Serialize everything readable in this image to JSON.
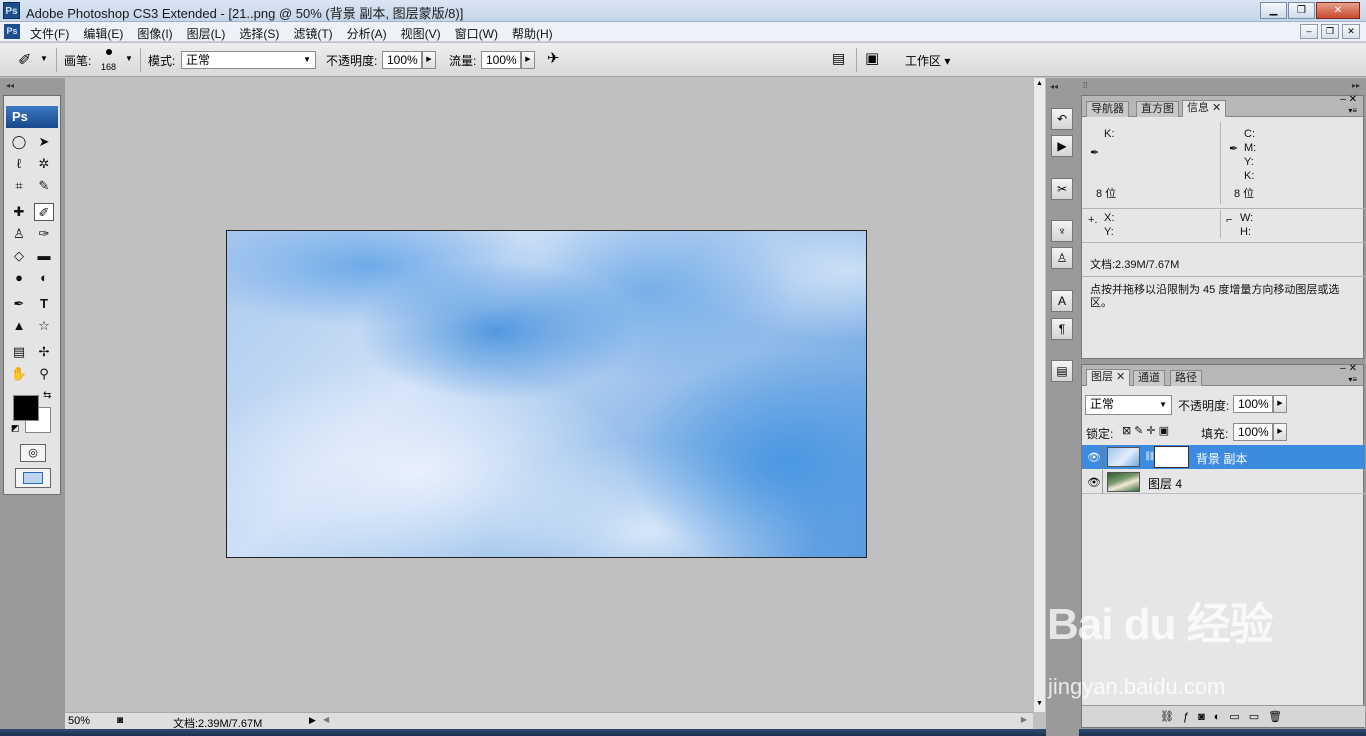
{
  "window": {
    "title": "Adobe Photoshop CS3 Extended - [21..png @ 50% (背景 副本, 图层蒙版/8)]",
    "app_icon": "Ps",
    "buttons": [
      "minimize",
      "maximize",
      "close"
    ]
  },
  "menu": {
    "items": [
      "文件(F)",
      "编辑(E)",
      "图像(I)",
      "图层(L)",
      "选择(S)",
      "滤镜(T)",
      "分析(A)",
      "视图(V)",
      "窗口(W)",
      "帮助(H)"
    ]
  },
  "options": {
    "brush_label": "画笔:",
    "brush_size": "168",
    "mode_label": "模式:",
    "mode_value": "正常",
    "opacity_label": "不透明度:",
    "opacity_value": "100%",
    "flow_label": "流量:",
    "flow_value": "100%",
    "workspace_label": "工作区 ▾"
  },
  "toolbox": {
    "logo": "Ps",
    "tools": [
      {
        "name": "marquee-icon",
        "glyph": "◯"
      },
      {
        "name": "move-icon",
        "glyph": "➤"
      },
      {
        "name": "lasso-icon",
        "glyph": "ℓ"
      },
      {
        "name": "magic-wand-icon",
        "glyph": "✲"
      },
      {
        "name": "crop-icon",
        "glyph": "⌗"
      },
      {
        "name": "slice-icon",
        "glyph": "✎"
      },
      {
        "name": "healing-brush-icon",
        "glyph": "✚"
      },
      {
        "name": "brush-icon",
        "glyph": "✐"
      },
      {
        "name": "clone-stamp-icon",
        "glyph": "♙"
      },
      {
        "name": "history-brush-icon",
        "glyph": "✑"
      },
      {
        "name": "eraser-icon",
        "glyph": "◇"
      },
      {
        "name": "gradient-icon",
        "glyph": "▬"
      },
      {
        "name": "blur-icon",
        "glyph": "●"
      },
      {
        "name": "dodge-icon",
        "glyph": "◐"
      },
      {
        "name": "pen-icon",
        "glyph": "✒"
      },
      {
        "name": "type-icon",
        "glyph": "T"
      },
      {
        "name": "path-select-icon",
        "glyph": "▲"
      },
      {
        "name": "shape-icon",
        "glyph": "☆"
      },
      {
        "name": "notes-icon",
        "glyph": "▤"
      },
      {
        "name": "eyedropper-icon",
        "glyph": "✢"
      },
      {
        "name": "hand-icon",
        "glyph": "✋"
      },
      {
        "name": "zoom-icon",
        "glyph": "⚲"
      }
    ],
    "fg_color": "#000000",
    "bg_color": "#ffffff"
  },
  "status": {
    "zoom": "50%",
    "doc_info": "文档:2.39M/7.67M"
  },
  "info_panel": {
    "tabs": [
      "导航器",
      "直方图",
      "信息"
    ],
    "active_tab": "信息",
    "k_left": "K:",
    "c_label": "C:",
    "m_label": "M:",
    "y_label": "Y:",
    "k_right": "K:",
    "bits_left": "8 位",
    "bits_right": "8 位",
    "x_label": "X:",
    "y_coord_label": "Y:",
    "w_label": "W:",
    "h_label": "H:",
    "doc_info": "文档:2.39M/7.67M",
    "hint": "点按并拖移以沿限制为 45 度增量方向移动图层或选区。"
  },
  "layers_panel": {
    "tabs": [
      "图层",
      "通道",
      "路径"
    ],
    "active_tab": "图层",
    "blend_mode": "正常",
    "opacity_label": "不透明度:",
    "opacity_value": "100%",
    "lock_label": "锁定:",
    "fill_label": "填充:",
    "fill_value": "100%",
    "layers": [
      {
        "name": "背景 副本",
        "selected": true
      },
      {
        "name": "图层 4",
        "selected": false
      }
    ]
  },
  "watermark": {
    "brand": "Bai du 经验",
    "url": "jingyan.baidu.com"
  }
}
